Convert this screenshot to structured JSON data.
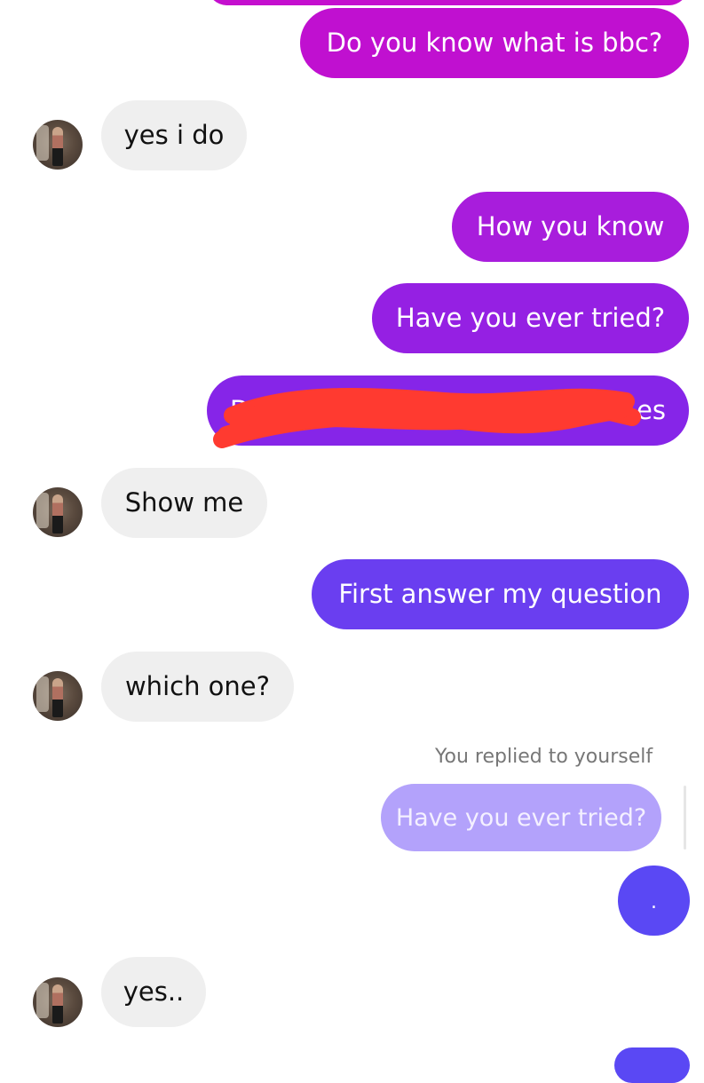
{
  "messages": [
    {
      "from": "me",
      "text": ""
    },
    {
      "from": "me",
      "text": "Do you know what is bbc?"
    },
    {
      "from": "them",
      "text": "yes i do"
    },
    {
      "from": "me",
      "text": "How you know"
    },
    {
      "from": "me",
      "text": "Have you ever tried?"
    },
    {
      "from": "me",
      "text": "Do",
      "text_end": "es",
      "redacted": true
    },
    {
      "from": "them",
      "text": "Show me"
    },
    {
      "from": "me",
      "text": "First answer my question"
    },
    {
      "from": "them",
      "text": "which one?"
    },
    {
      "from": "me",
      "reply_note": "You replied to yourself",
      "quoted": "Have you ever tried?"
    },
    {
      "from": "me",
      "text": "."
    },
    {
      "from": "them",
      "text": "yes.."
    },
    {
      "from": "me",
      "text": ""
    }
  ],
  "colors": {
    "gradient_top": "#c20fd1",
    "gradient_mid": "#9520e3",
    "gradient_bottom": "#5a48f4",
    "incoming_bubble": "#efefef",
    "quoted_bubble": "#b3a2fb",
    "redaction": "#ff3a30"
  },
  "icons": {
    "avatar": "avatar-photo"
  }
}
